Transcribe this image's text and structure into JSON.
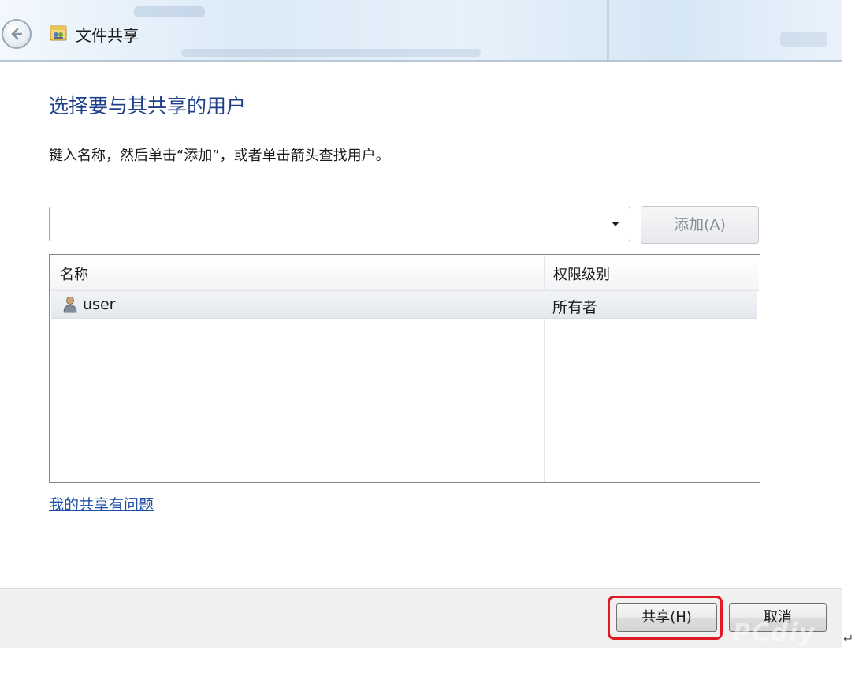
{
  "window": {
    "title": "文件共享"
  },
  "content": {
    "heading": "选择要与其共享的用户",
    "instruction": "键入名称，然后单击“添加”，或者单击箭头查找用户。",
    "name_input": {
      "value": "",
      "placeholder": ""
    },
    "add_button_label": "添加(A)",
    "help_link": "我的共享有问题"
  },
  "list": {
    "columns": [
      "名称",
      "权限级别"
    ],
    "rows": [
      {
        "name": "user",
        "permission": "所有者",
        "icon": "user-icon"
      }
    ]
  },
  "footer": {
    "share_button_label": "共享(H)",
    "cancel_button_label": "取消"
  },
  "watermark": "PCdiy",
  "colors": {
    "heading": "#1e3f8a",
    "link": "#1e4fa8",
    "highlight": "#e01b24"
  }
}
